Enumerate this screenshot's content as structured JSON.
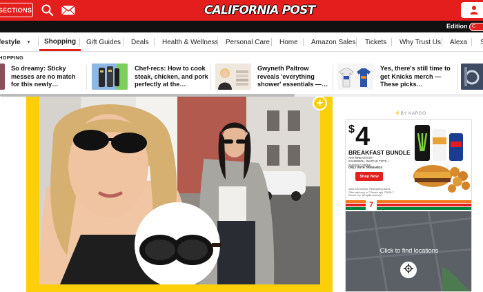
{
  "header": {
    "sections_label": "SECTIONS",
    "logo_text": "CALIFORNIA POST",
    "icons": [
      "search-icon",
      "mail-icon",
      "user-icon"
    ],
    "accent": "#e41d1d"
  },
  "edition": {
    "label": "Edition",
    "toggle_value": "C"
  },
  "nav": {
    "items": [
      {
        "label": "festyle"
      },
      {
        "label": "Shopping"
      },
      {
        "label": "Gift Guides"
      },
      {
        "label": "Deals"
      },
      {
        "label": "Health & Wellness"
      },
      {
        "label": "Personal Care"
      },
      {
        "label": "Home"
      },
      {
        "label": "Amazon Sales"
      },
      {
        "label": "Tickets"
      },
      {
        "label": "Why Trust Us"
      },
      {
        "label": "Alexa"
      },
      {
        "label": "S"
      }
    ],
    "active": "Shopping"
  },
  "shopping": {
    "label": "HOPPING",
    "cards": [
      {
        "title": "So dreamy: Sticky messes are no match for this newly…"
      },
      {
        "title": "Chef-recs: How to cook steak, chicken, and pork perfectly at the…"
      },
      {
        "title": "Gwyneth Paltrow reveals 'everything shower' essentials —…"
      },
      {
        "title": "Yes, there's still time to get Knicks merch — These picks…"
      }
    ]
  },
  "hero": {
    "frame_color": "#fccf0a",
    "plus_label": "+"
  },
  "ad": {
    "sponsor": "⚡BY KARGO",
    "price_symbol": "$",
    "price": "4",
    "headline": "BREAKFAST BUNDLE",
    "details": "ANY BREAKFAST SANDWICH, WAFFLE TOTS + ENERGY DRINK",
    "app_text": "ONLY WITH 7REWARDS",
    "shop_label": "Shop Now",
    "fine_print": "Valid thru 6/30/26. Participating stores. Offer valid only in 7-Eleven app. ©2026 7-Eleven, Inc. All rights reserved.",
    "brand_badge": "7-ELEVEN",
    "map_text": "Click to find locations",
    "product_labels": [
      "MONSTER",
      "CELSIUS",
      "RED BULL"
    ]
  }
}
